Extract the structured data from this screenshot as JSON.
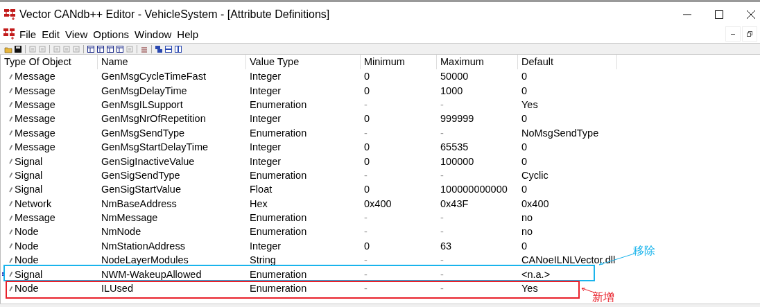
{
  "window": {
    "title": "Vector CANdb++ Editor - VehicleSystem - [Attribute Definitions]"
  },
  "menu": [
    "File",
    "Edit",
    "View",
    "Options",
    "Window",
    "Help"
  ],
  "table": {
    "columns": [
      "Type Of Object",
      "Name",
      "Value Type",
      "Minimum",
      "Maximum",
      "Default"
    ],
    "rows": [
      {
        "cells": [
          "Message",
          "GenMsgCycleTimeFast",
          "Integer",
          "0",
          "50000",
          "0"
        ]
      },
      {
        "cells": [
          "Message",
          "GenMsgDelayTime",
          "Integer",
          "0",
          "1000",
          "0"
        ]
      },
      {
        "cells": [
          "Message",
          "GenMsgILSupport",
          "Enumeration",
          "-",
          "-",
          "Yes"
        ]
      },
      {
        "cells": [
          "Message",
          "GenMsgNrOfRepetition",
          "Integer",
          "0",
          "999999",
          "0"
        ]
      },
      {
        "cells": [
          "Message",
          "GenMsgSendType",
          "Enumeration",
          "-",
          "-",
          "NoMsgSendType"
        ]
      },
      {
        "cells": [
          "Message",
          "GenMsgStartDelayTime",
          "Integer",
          "0",
          "65535",
          "0"
        ]
      },
      {
        "cells": [
          "Signal",
          "GenSigInactiveValue",
          "Integer",
          "0",
          "100000",
          "0"
        ]
      },
      {
        "cells": [
          "Signal",
          "GenSigSendType",
          "Enumeration",
          "-",
          "-",
          "Cyclic"
        ]
      },
      {
        "cells": [
          "Signal",
          "GenSigStartValue",
          "Float",
          "0",
          "100000000000",
          "0"
        ]
      },
      {
        "cells": [
          "Network",
          "NmBaseAddress",
          "Hex",
          "0x400",
          "0x43F",
          "0x400"
        ]
      },
      {
        "cells": [
          "Message",
          "NmMessage",
          "Enumeration",
          "-",
          "-",
          "no"
        ]
      },
      {
        "cells": [
          "Node",
          "NmNode",
          "Enumeration",
          "-",
          "-",
          "no"
        ]
      },
      {
        "cells": [
          "Node",
          "NmStationAddress",
          "Integer",
          "0",
          "63",
          "0"
        ]
      },
      {
        "cells": [
          "Node",
          "NodeLayerModules",
          "String",
          "-",
          "-",
          "CANoeILNLVector.dll"
        ]
      },
      {
        "cells": [
          "Signal",
          "NWM-WakeupAllowed",
          "Enumeration",
          "-",
          "-",
          "<n.a.>"
        ],
        "current": true,
        "annotation": {
          "label": "移除",
          "color": "#1ab4ec"
        }
      },
      {
        "cells": [
          "Node",
          "ILUsed",
          "Enumeration",
          "-",
          "-",
          "Yes"
        ],
        "annotation": {
          "label": "新增",
          "color": "#e8202a"
        }
      }
    ]
  }
}
